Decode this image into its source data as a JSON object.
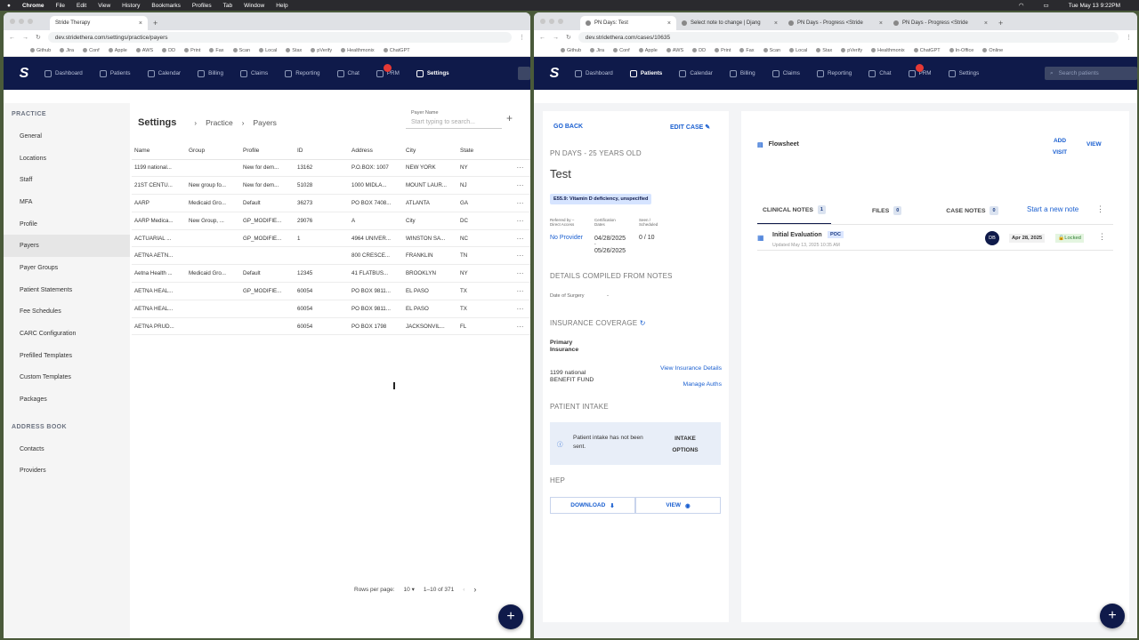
{
  "os": {
    "app": "Chrome",
    "menus": [
      "File",
      "Edit",
      "View",
      "History",
      "Bookmarks",
      "Profiles",
      "Tab",
      "Window",
      "Help"
    ],
    "clock": "Tue May 13  9:22PM"
  },
  "left": {
    "tabs": [
      {
        "title": "Stride Therapy"
      }
    ],
    "url": "dev.stridethera.com/settings/practice/payers",
    "bookmarks": [
      "Github",
      "Jira",
      "Conf",
      "Apple",
      "AWS",
      "DD",
      "Print",
      "Fax",
      "Scan",
      "Local",
      "Stax",
      "pVerify",
      "Healthmonix",
      "ChatGPT"
    ],
    "nav": [
      {
        "label": "Dashboard"
      },
      {
        "label": "Patients"
      },
      {
        "label": "Calendar"
      },
      {
        "label": "Billing"
      },
      {
        "label": "Claims"
      },
      {
        "label": "Reporting"
      },
      {
        "label": "Chat"
      },
      {
        "label": "PRM"
      },
      {
        "label": "Settings"
      }
    ],
    "sidebar": {
      "practice_head": "PRACTICE",
      "items": [
        "General",
        "Locations",
        "Staff",
        "MFA",
        "Profile",
        "Payers",
        "Payer Groups",
        "Patient Statements",
        "Fee Schedules",
        "CARC Configuration",
        "Prefilled Templates",
        "Custom Templates",
        "Packages"
      ],
      "address_head": "ADDRESS BOOK",
      "address_items": [
        "Contacts",
        "Providers"
      ]
    },
    "header": {
      "title": "Settings",
      "crumb1": "Practice",
      "crumb2": "Payers",
      "search_label": "Payer Name",
      "search_placeholder": "Start typing to search..."
    },
    "columns": [
      "Name",
      "Group",
      "Profile",
      "ID",
      "Address",
      "City",
      "State"
    ],
    "rows": [
      [
        "1199 national...",
        "",
        "New for dem...",
        "13162",
        "P.O.BOX: 1007",
        "NEW YORK",
        "NY"
      ],
      [
        "21ST CENTU...",
        "New group fo...",
        "New for dem...",
        "51028",
        "1000 MIDLA...",
        "MOUNT LAUR...",
        "NJ"
      ],
      [
        "AARP",
        "Medicaid Gro...",
        "Default",
        "36273",
        "PO BOX 7408...",
        "ATLANTA",
        "GA"
      ],
      [
        "AARP Medica...",
        "New Group, ...",
        "GP_MODIFIE...",
        "29076",
        "A",
        "City",
        "DC"
      ],
      [
        "ACTUARIAL ...",
        "",
        "GP_MODIFIE...",
        "1",
        "4964 UNIVER...",
        "WINSTON SA...",
        "NC"
      ],
      [
        "AETNA AETN...",
        "",
        "",
        "",
        "800 CRESCE...",
        "FRANKLIN",
        "TN"
      ],
      [
        "Aetna Health ...",
        "Medicaid Gro...",
        "Default",
        "12345",
        "41 FLATBUS...",
        "BROOKLYN",
        "NY"
      ],
      [
        "AETNA HEAL...",
        "",
        "GP_MODIFIE...",
        "60054",
        "PO BOX 9811...",
        "EL PASO",
        "TX"
      ],
      [
        "AETNA HEAL...",
        "",
        "",
        "60054",
        "PO BOX 9811...",
        "EL PASO",
        "TX"
      ],
      [
        "AETNA PRUD...",
        "",
        "",
        "60054",
        "PO BOX 1798",
        "JACKSONVIL...",
        "FL"
      ]
    ],
    "pager": {
      "rows_label": "Rows per page:",
      "rows_value": "10",
      "range": "1–10 of 371"
    }
  },
  "right": {
    "tabs": [
      {
        "title": "PN Days: Test"
      },
      {
        "title": "Select note to change | Djang"
      },
      {
        "title": "PN Days - Progress <Stride"
      },
      {
        "title": "PN Days - Progress <Stride"
      }
    ],
    "url": "dev.stridethera.com/cases/10635",
    "bookmarks": [
      "Github",
      "Jira",
      "Conf",
      "Apple",
      "AWS",
      "DD",
      "Print",
      "Fax",
      "Scan",
      "Local",
      "Stax",
      "pVerify",
      "Healthmonix",
      "ChatGPT",
      "In-Office",
      "Online"
    ],
    "nav": [
      {
        "label": "Dashboard"
      },
      {
        "label": "Patients"
      },
      {
        "label": "Calendar"
      },
      {
        "label": "Billing"
      },
      {
        "label": "Claims"
      },
      {
        "label": "Reporting"
      },
      {
        "label": "Chat"
      },
      {
        "label": "PRM"
      },
      {
        "label": "Settings"
      }
    ],
    "search_placeholder": "Search patients",
    "case": {
      "go_back": "GO BACK",
      "edit_case": "EDIT CASE",
      "subtitle": "PN DAYS - 25 YEARS OLD",
      "name": "Test",
      "diagnosis": "E55.9: Vitamin D deficiency, unspecified",
      "referred_label": "Referred by – Direct Access",
      "cert_label": "Certification Dates",
      "seen_label": "Seen / Scheduled",
      "referred_value": "No Provider",
      "cert_start": "04/28/2025",
      "cert_dash": "-",
      "cert_end": "05/26/2025",
      "seen_value": "0 / 10",
      "details_head": "DETAILS COMPILED FROM NOTES",
      "surgery_label": "Date of Surgery",
      "surgery_value": "-",
      "insurance_head": "INSURANCE COVERAGE",
      "primary_label": "Primary Insurance",
      "insurer": "1199 national BENEFIT FUND",
      "view_ins": "View Insurance Details",
      "manage_auths": "Manage Auths",
      "intake_head": "PATIENT INTAKE",
      "intake_msg": "Patient intake has not been sent.",
      "intake_options": "INTAKE OPTIONS",
      "hep_head": "HEP",
      "download": "DOWNLOAD",
      "view": "VIEW"
    },
    "flow": {
      "title": "Flowsheet",
      "add_visit": "ADD VISIT",
      "view": "VIEW",
      "tabs": [
        {
          "label": "CLINICAL NOTES",
          "count": "1"
        },
        {
          "label": "FILES",
          "count": "0"
        },
        {
          "label": "CASE NOTES",
          "count": "0"
        }
      ],
      "new_note": "Start a new note",
      "note": {
        "title": "Initial Evaluation",
        "badge": "POC",
        "updated": "Updated May 13, 2025 10:35 AM",
        "initials": "DB",
        "date": "Apr 28, 2025",
        "status": "Locked"
      }
    }
  }
}
